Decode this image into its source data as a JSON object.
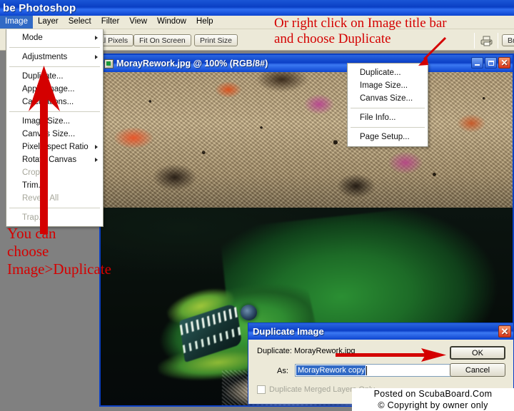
{
  "app": {
    "title": "be Photoshop"
  },
  "menubar": {
    "items": [
      {
        "label": "Image",
        "active": true
      },
      {
        "label": "Layer",
        "active": false
      },
      {
        "label": "Select",
        "active": false
      },
      {
        "label": "Filter",
        "active": false
      },
      {
        "label": "View",
        "active": false
      },
      {
        "label": "Window",
        "active": false
      },
      {
        "label": "Help",
        "active": false
      }
    ]
  },
  "options_bar": {
    "buttons": [
      {
        "label": "al Pixels"
      },
      {
        "label": "Fit On Screen"
      },
      {
        "label": "Print Size"
      },
      {
        "label": "Bru"
      }
    ],
    "print_icon": "printer-icon"
  },
  "image_menu": {
    "items": [
      {
        "label": "Mode",
        "submenu": true,
        "disabled": false
      },
      {
        "separator": true
      },
      {
        "label": "Adjustments",
        "submenu": true,
        "disabled": false
      },
      {
        "separator": true
      },
      {
        "label": "Duplicate...",
        "submenu": false,
        "disabled": false
      },
      {
        "label": "Apply Image...",
        "submenu": false,
        "disabled": false
      },
      {
        "label": "Calculations...",
        "submenu": false,
        "disabled": false
      },
      {
        "separator": true
      },
      {
        "label": "Image Size...",
        "submenu": false,
        "disabled": false
      },
      {
        "label": "Canvas Size...",
        "submenu": false,
        "disabled": false
      },
      {
        "label": "Pixel Aspect Ratio",
        "submenu": true,
        "disabled": false
      },
      {
        "label": "Rotate Canvas",
        "submenu": true,
        "disabled": false
      },
      {
        "label": "Crop",
        "submenu": false,
        "disabled": true
      },
      {
        "label": "Trim...",
        "submenu": false,
        "disabled": false
      },
      {
        "label": "Reveal All",
        "submenu": false,
        "disabled": true
      },
      {
        "separator": true
      },
      {
        "label": "Trap...",
        "submenu": false,
        "disabled": true
      }
    ]
  },
  "context_menu": {
    "items": [
      {
        "label": "Duplicate..."
      },
      {
        "label": "Image Size..."
      },
      {
        "label": "Canvas Size..."
      },
      {
        "separator": true
      },
      {
        "label": "File Info..."
      },
      {
        "separator": true
      },
      {
        "label": "Page Setup..."
      }
    ]
  },
  "document_window": {
    "title": "MorayRework.jpg @  100% (RGB/8#)",
    "icon": "photoshop-document-icon",
    "minimize": "minimize-icon",
    "maximize": "maximize-icon",
    "close": "close-icon"
  },
  "dialog": {
    "title": "Duplicate Image",
    "close_label": "✕",
    "duplicate_line": "Duplicate: MorayRework.jpg",
    "as_label": "As:",
    "as_value": "MorayRework copy",
    "checkbox_label": "Duplicate Merged Layers Only",
    "checkbox_checked": false,
    "ok_label": "OK",
    "cancel_label": "Cancel"
  },
  "annotations": {
    "top_right": "Or right click on Image title bar\nand choose Duplicate",
    "bottom_left": "You can\nchoose\nImage>Duplicate",
    "arrow_color": "#d40000"
  },
  "watermark": {
    "line1": "Posted on ScubaBoard.Com",
    "line2": "© Copyright by owner only"
  },
  "colors": {
    "titlebar_blue": "#0b3fc6",
    "chrome": "#ece9d8",
    "menu_highlight": "#316ac5",
    "annotation_red": "#d40000",
    "desktop_gray": "#808080"
  }
}
